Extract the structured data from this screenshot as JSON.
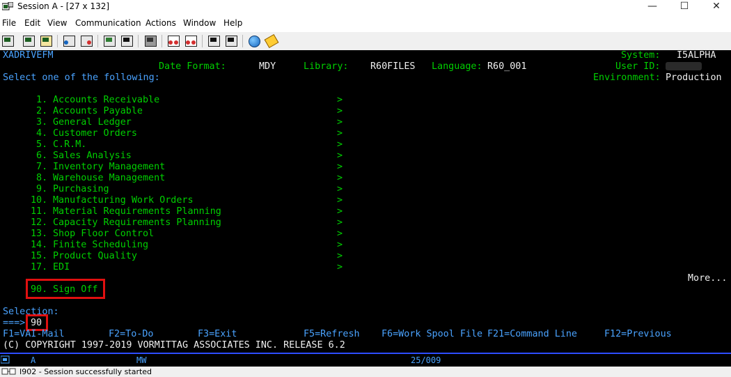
{
  "window": {
    "title": "Session A - [27 x 132]",
    "minimize": "—",
    "maximize": "☐",
    "close": "✕"
  },
  "menu": [
    "File",
    "Edit",
    "View",
    "Communication",
    "Actions",
    "Window",
    "Help"
  ],
  "toolbar_icons": [
    "print-screen-icon",
    "copy-icon",
    "paste-icon",
    "send-icon",
    "receive-icon",
    "display-icon",
    "keyboard-icon",
    "record-macro-icon",
    "play-macro-icon",
    "macro-icon",
    "stop-icon",
    "play-icon",
    "globe-icon",
    "tag-icon"
  ],
  "header": {
    "program": "XADRIVEFM",
    "system_label": "System:",
    "system_value": "I5ALPHA",
    "date_format_label": "Date Format:",
    "date_format_value": "MDY",
    "library_label": "Library:",
    "library_value": "R60FILES",
    "language_label": "Language:",
    "language_value": "R60_001",
    "user_id_label": "User ID:",
    "user_id_value": "",
    "environment_label": "Environment:",
    "environment_value": "Production",
    "instruction": "Select one of the following:"
  },
  "menu_items": [
    {
      "num": " 1.",
      "label": "Accounts Receivable",
      "more": ">"
    },
    {
      "num": " 2.",
      "label": "Accounts Payable",
      "more": ">"
    },
    {
      "num": " 3.",
      "label": "General Ledger",
      "more": ">"
    },
    {
      "num": " 4.",
      "label": "Customer Orders",
      "more": ">"
    },
    {
      "num": " 5.",
      "label": "C.R.M.",
      "more": ">"
    },
    {
      "num": " 6.",
      "label": "Sales Analysis",
      "more": ">"
    },
    {
      "num": " 7.",
      "label": "Inventory Management",
      "more": ">"
    },
    {
      "num": " 8.",
      "label": "Warehouse Management",
      "more": ">"
    },
    {
      "num": " 9.",
      "label": "Purchasing",
      "more": ">"
    },
    {
      "num": "10.",
      "label": "Manufacturing Work Orders",
      "more": ">"
    },
    {
      "num": "11.",
      "label": "Material Requirements Planning",
      "more": ">"
    },
    {
      "num": "12.",
      "label": "Capacity Requirements Planning",
      "more": ">"
    },
    {
      "num": "13.",
      "label": "Shop Floor Control",
      "more": ">"
    },
    {
      "num": "14.",
      "label": "Finite Scheduling",
      "more": ">"
    },
    {
      "num": "15.",
      "label": "Product Quality",
      "more": ">"
    },
    {
      "num": "17.",
      "label": "EDI",
      "more": ">"
    }
  ],
  "more_text": "More...",
  "sign_off": {
    "num": "90.",
    "label": "Sign Off"
  },
  "selection_label": "Selection:",
  "prompt": "===>",
  "selection_value": "90",
  "fkeys": [
    "F1=VAI-Mail",
    "F2=To-Do",
    "F3=Exit",
    "F5=Refresh",
    "F6=Work Spool File",
    "F21=Command Line",
    "F12=Previous"
  ],
  "copyright": "(C) COPYRIGHT 1997-2019 VORMITTAG ASSOCIATES INC. RELEASE 6.2",
  "oia": {
    "indicator": "A",
    "mode": "MW",
    "cursor": "25/009"
  },
  "status_message": "I902 - Session successfully started"
}
